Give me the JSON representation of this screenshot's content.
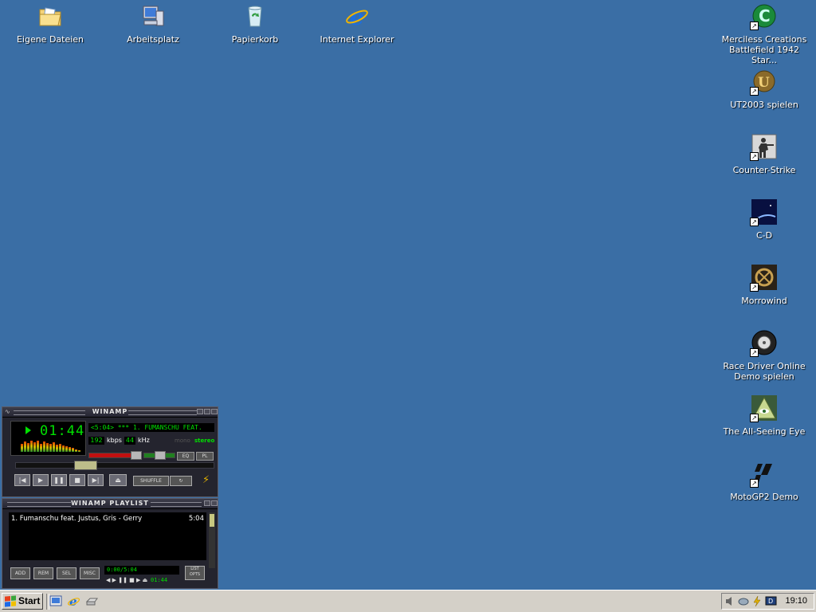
{
  "desktop": {
    "icons": [
      {
        "id": "eigene-dateien",
        "label": "Eigene Dateien",
        "icon": "folder-documents-icon"
      },
      {
        "id": "arbeitsplatz",
        "label": "Arbeitsplatz",
        "icon": "computer-icon"
      },
      {
        "id": "papierkorb",
        "label": "Papierkorb",
        "icon": "recycle-bin-icon"
      },
      {
        "id": "internet-explorer",
        "label": "Internet Explorer",
        "icon": "internet-explorer-icon"
      },
      {
        "id": "merciless",
        "label": "Merciless Creations Battlefield 1942 Star...",
        "icon": "battlefield-icon"
      },
      {
        "id": "ut2003",
        "label": "UT2003 spielen",
        "icon": "ut2003-icon"
      },
      {
        "id": "counter-strike",
        "label": "Counter-Strike",
        "icon": "counter-strike-icon"
      },
      {
        "id": "c-d",
        "label": "C-D",
        "icon": "c-d-icon"
      },
      {
        "id": "morrowind",
        "label": "Morrowind",
        "icon": "morrowind-icon"
      },
      {
        "id": "race-driver",
        "label": "Race Driver Online Demo spielen",
        "icon": "race-driver-icon"
      },
      {
        "id": "all-seeing-eye",
        "label": "The All-Seeing Eye",
        "icon": "all-seeing-eye-icon"
      },
      {
        "id": "motogp2",
        "label": "MotoGP2 Demo",
        "icon": "motogp-icon"
      }
    ]
  },
  "winamp": {
    "title": "WINAMP",
    "time": "01:44",
    "marquee": "<5:04>  ***  1. FUMANSCHU FEAT.",
    "kbps": "192",
    "kbps_unit": "kbps",
    "khz": "44",
    "khz_unit": "kHz",
    "mono": "mono",
    "stereo": "stereo",
    "eq": "EQ",
    "pl": "PL",
    "shuffle": "SHUFFLE",
    "volume_fraction": 0.85,
    "seek_fraction": 0.34,
    "transport": [
      "prev",
      "play",
      "pause",
      "stop",
      "next",
      "eject"
    ]
  },
  "playlist": {
    "title": "WINAMP PLAYLIST",
    "items": [
      {
        "title": "1. Fumanschu feat. Justus, Gris - Gerry",
        "length": "5:04"
      }
    ],
    "time_display": "0:00/5:04",
    "current": "01:44",
    "buttons": {
      "add": "ADD",
      "rem": "REM",
      "sel": "SEL",
      "misc": "MISC",
      "list": "LIST OPTS"
    }
  },
  "taskbar": {
    "start_label": "Start",
    "quicklaunch": [
      "show-desktop-icon",
      "internet-explorer-icon",
      "hard-drive-icon"
    ],
    "tray": [
      "volume-icon",
      "network-icon",
      "power-icon",
      "monitor-icon"
    ],
    "clock": "19:10"
  }
}
